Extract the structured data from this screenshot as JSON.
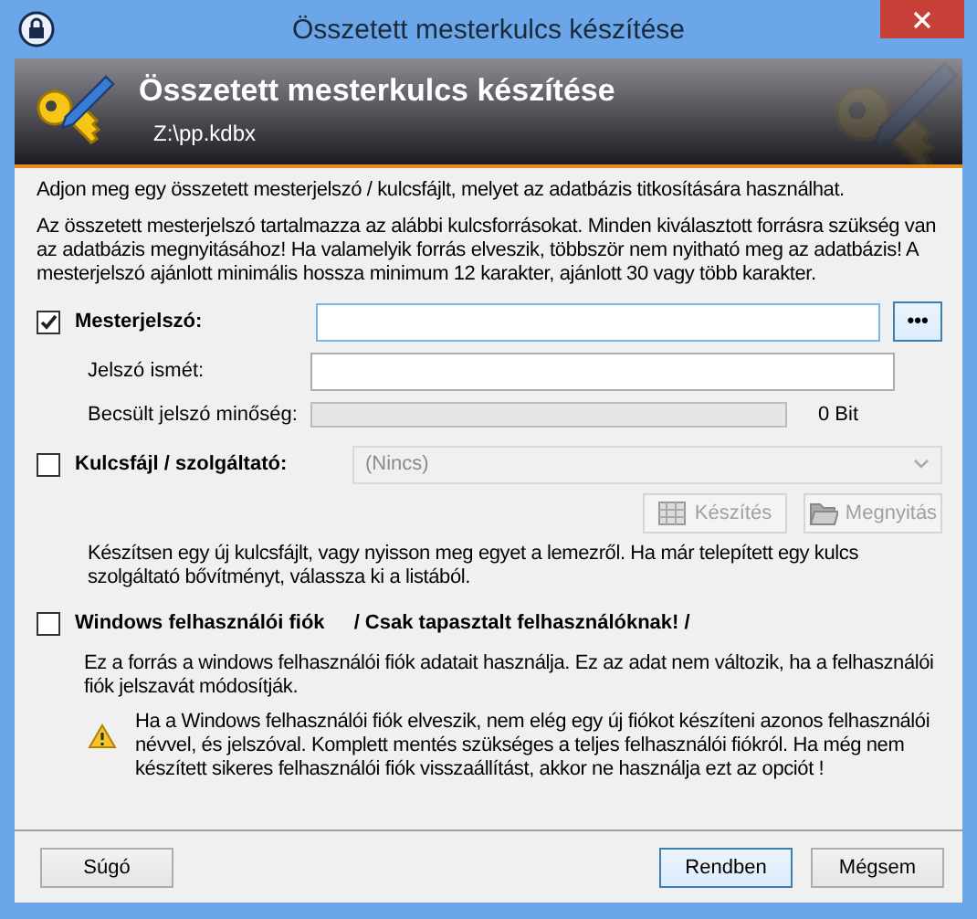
{
  "window": {
    "title": "Összetett mesterkulcs készítése"
  },
  "banner": {
    "title": "Összetett mesterkulcs készítése",
    "subtitle": "Z:\\pp.kdbx"
  },
  "intro": "Adjon meg egy összetett mesterjelszó / kulcsfájlt, melyet az adatbázis titkosítására használhat.",
  "description": "Az összetett mesterjelszó tartalmazza az alábbi kulcsforrásokat. Minden kiválasztott forrásra szükség van az adatbázis megnyitásához! Ha valamelyik forrás elveszik, többször nem nyitható meg az adatbázis! A mesterjelszó ajánlott minimális hossza minimum 12 karakter, ajánlott 30 vagy több karakter.",
  "master_password": {
    "label": "Mesterjelszó:",
    "checked": true,
    "reveal_button": "•••",
    "repeat_label": "Jelszó ismét:",
    "quality_label": "Becsült jelszó minőség:",
    "level": 0,
    "quality_reading": "0 Bit"
  },
  "key_file": {
    "label": "Kulcsfájl / szolgáltató:",
    "checked": false,
    "selection": "(Nincs)",
    "disabled": true,
    "buttons": [
      {
        "label": "Készítés",
        "kind": "create",
        "disabled": true
      },
      {
        "label": "Megnyitás",
        "kind": "open",
        "disabled": true
      }
    ],
    "help": "Készítsen egy új kulcsfájlt, vagy nyisson meg egyet a lemezről. Ha már telepített egy kulcs szolgáltató bővítményt, válassza ki a listából."
  },
  "user_account": {
    "label": "Windows felhasználói fiók",
    "note": "/ Csak tapasztalt felhasználóknak! /",
    "checked": false,
    "help": "Ez a forrás a windows felhasználói fiók adatait használja. Ez az adat nem változik, ha a felhasználói fiók jelszavát módosítják.",
    "warning": "Ha a Windows felhasználói fiók elveszik, nem elég egy új fiókot készíteni azonos felhasználói névvel, és jelszóval. Komplett mentés szükséges a teljes felhasználói fiókról. Ha még nem készített sikeres felhasználói fiók visszaállítást, akkor ne használja ezt az opciót !"
  },
  "buttons": [
    {
      "label": "Súgó",
      "default": false
    },
    {
      "label": "Rendben",
      "default": true
    },
    {
      "label": "Mégsem",
      "default": false
    }
  ]
}
